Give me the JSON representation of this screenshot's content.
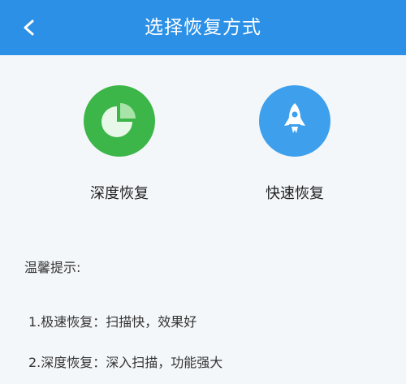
{
  "header": {
    "title": "选择恢复方式",
    "back_icon": "chevron-left-icon",
    "color": "#2b90e6"
  },
  "options": [
    {
      "label": "深度恢复",
      "icon": "pie-chart-icon",
      "color": "#3cb648"
    },
    {
      "label": "快速恢复",
      "icon": "rocket-icon",
      "color": "#3ea0ec"
    }
  ],
  "tips": {
    "title": "温馨提示:",
    "items": [
      "1.极速恢复：扫描快，效果好",
      "2.深度恢复：深入扫描，功能强大"
    ]
  }
}
